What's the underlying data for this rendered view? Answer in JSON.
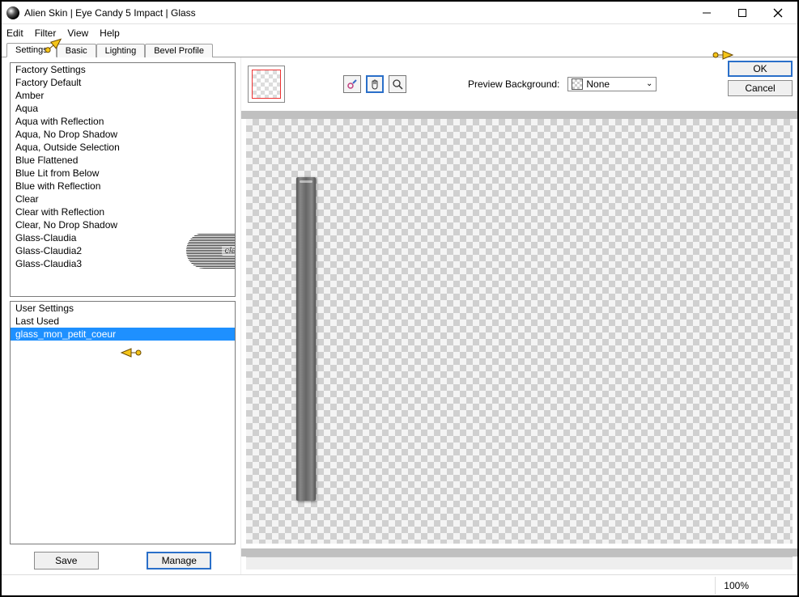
{
  "window": {
    "title": "Alien Skin | Eye Candy 5 Impact | Glass"
  },
  "menubar": {
    "items": [
      "Edit",
      "Filter",
      "View",
      "Help"
    ]
  },
  "tabs": [
    "Settings",
    "Basic",
    "Lighting",
    "Bevel Profile"
  ],
  "active_tab": "Settings",
  "factory": {
    "header": "Factory Settings",
    "items": [
      "Factory Default",
      "Amber",
      "Aqua",
      "Aqua with Reflection",
      "Aqua, No Drop Shadow",
      "Aqua, Outside Selection",
      "Blue Flattened",
      "Blue Lit from Below",
      "Blue with Reflection",
      "Clear",
      "Clear with Reflection",
      "Clear, No Drop Shadow",
      "Glass-Claudia",
      "Glass-Claudia2",
      "Glass-Claudia3"
    ]
  },
  "user": {
    "header": "User Settings",
    "items": [
      "Last Used",
      "glass_mon_petit_coeur"
    ],
    "selected": "glass_mon_petit_coeur"
  },
  "buttons": {
    "save": "Save",
    "manage": "Manage",
    "ok": "OK",
    "cancel": "Cancel"
  },
  "preview": {
    "bg_label": "Preview Background:",
    "bg_value": "None"
  },
  "watermark": "claudia",
  "status": {
    "zoom": "100%"
  }
}
